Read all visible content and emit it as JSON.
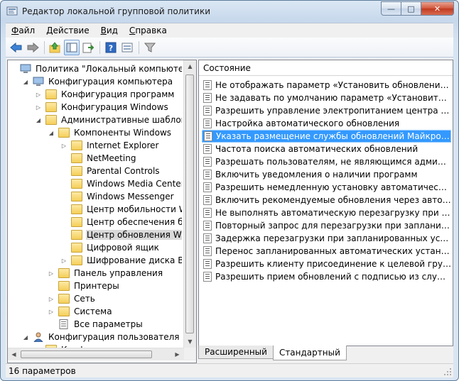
{
  "window": {
    "title": "Редактор локальной групповой политики",
    "caption_minimize": "—",
    "caption_maximize": "□",
    "caption_close": "✕"
  },
  "menu": [
    {
      "pre": "",
      "key": "Ф",
      "post": "айл"
    },
    {
      "pre": "",
      "key": "Д",
      "post": "ействие"
    },
    {
      "pre": "",
      "key": "В",
      "post": "ид"
    },
    {
      "pre": "",
      "key": "С",
      "post": "правка"
    }
  ],
  "toolbar": [
    "back-icon",
    "forward-icon",
    "up-folder-icon",
    "show-hide-tree-icon",
    "export-list-icon",
    "help-icon",
    "properties-icon",
    "filter-icon"
  ],
  "tree": {
    "items": [
      {
        "label": "Политика \"Локальный компьютер\"",
        "level": 0,
        "expander": "",
        "icon": "computer"
      },
      {
        "label": "Конфигурация компьютера",
        "level": 1,
        "expander": "open",
        "icon": "computer"
      },
      {
        "label": "Конфигурация программ",
        "level": 2,
        "expander": "closed",
        "icon": "folder"
      },
      {
        "label": "Конфигурация Windows",
        "level": 2,
        "expander": "closed",
        "icon": "folder"
      },
      {
        "label": "Административные шаблоны",
        "level": 2,
        "expander": "open",
        "icon": "folder"
      },
      {
        "label": "Компоненты Windows",
        "level": 3,
        "expander": "open",
        "icon": "folder"
      },
      {
        "label": "Internet Explorer",
        "level": 4,
        "expander": "closed",
        "icon": "folder"
      },
      {
        "label": "NetMeeting",
        "level": 4,
        "expander": "",
        "icon": "folder"
      },
      {
        "label": "Parental Controls",
        "level": 4,
        "expander": "",
        "icon": "folder"
      },
      {
        "label": "Windows Media Center",
        "level": 4,
        "expander": "",
        "icon": "folder"
      },
      {
        "label": "Windows Messenger",
        "level": 4,
        "expander": "",
        "icon": "folder"
      },
      {
        "label": "Центр мобильности Windows",
        "level": 4,
        "expander": "",
        "icon": "folder"
      },
      {
        "label": "Центр обеспечения безопасности",
        "level": 4,
        "expander": "",
        "icon": "folder"
      },
      {
        "label": "Центр обновления Windows",
        "level": 4,
        "expander": "",
        "icon": "folder",
        "selected": true
      },
      {
        "label": "Цифровой ящик",
        "level": 4,
        "expander": "",
        "icon": "folder"
      },
      {
        "label": "Шифрование диска BitLocker",
        "level": 4,
        "expander": "closed",
        "icon": "folder"
      },
      {
        "label": "Панель управления",
        "level": 3,
        "expander": "closed",
        "icon": "folder"
      },
      {
        "label": "Принтеры",
        "level": 3,
        "expander": "",
        "icon": "folder"
      },
      {
        "label": "Сеть",
        "level": 3,
        "expander": "closed",
        "icon": "folder"
      },
      {
        "label": "Система",
        "level": 3,
        "expander": "closed",
        "icon": "folder"
      },
      {
        "label": "Все параметры",
        "level": 3,
        "expander": "",
        "icon": "settings-page"
      },
      {
        "label": "Конфигурация пользователя",
        "level": 1,
        "expander": "open",
        "icon": "user"
      },
      {
        "label": "Конф",
        "level": 2,
        "expander": "closed",
        "icon": "folder"
      }
    ]
  },
  "list": {
    "column_header": "Состояние",
    "items": [
      "Не отображать параметр «Установить обновления и заве...",
      "Не задавать по умолчанию параметр «Установить обнов...",
      "Разрешить управление электропитанием центра обновле...",
      "Настройка автоматического обновления",
      "Указать размещение службы обновлений Майкрософт в...",
      "Частота поиска автоматических обновлений",
      "Разрешать пользователям, не являющимся администрат...",
      "Включить уведомления о наличии программ",
      "Разрешить немедленную установку автоматических обнов...",
      "Включить рекомендуемые обновления через автоматиче...",
      "Не выполнять автоматическую перезагрузку при автома...",
      "Повторный запрос для перезагрузки при запланированн...",
      "Задержка перезагрузки при запланированных установках",
      "Перенос запланированных автоматических установок обн...",
      "Разрешить клиенту присоединение к целевой группе",
      "Разрешить прием обновлений с подписью из службы обн..."
    ],
    "selected_index": 4
  },
  "tabs": [
    {
      "label": "Расширенный",
      "active": false
    },
    {
      "label": "Стандартный",
      "active": true
    }
  ],
  "status": {
    "text": "16 параметров"
  },
  "colors": {
    "selection": "#3399ff",
    "tree_selection": "#d9d9d9",
    "folder": "#f5cf59"
  }
}
